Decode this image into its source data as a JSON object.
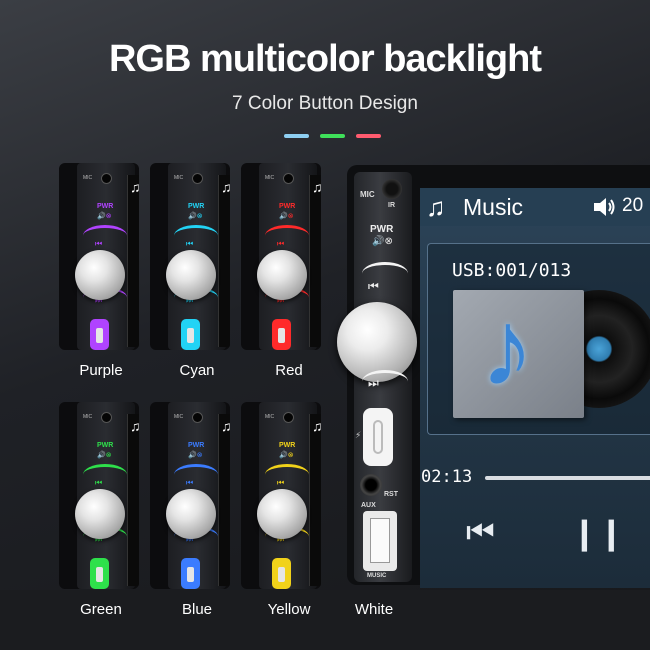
{
  "header": {
    "title": "RGB multicolor backlight",
    "subtitle": "7 Color Button Design",
    "dash_colors": [
      "#8ecff2",
      "#3fe05a",
      "#ff5b6f"
    ]
  },
  "panel_text": {
    "mic": "MIC",
    "pwr": "PWR",
    "pwr_symbol": "🔊⊗",
    "note": "♫",
    "prev": "⏮",
    "next": "⏭"
  },
  "variants": [
    {
      "label": "Purple",
      "color": "#b043ff"
    },
    {
      "label": "Cyan",
      "color": "#22d3f5"
    },
    {
      "label": "Red",
      "color": "#ff2a2a"
    },
    {
      "label": "Green",
      "color": "#2ee04b"
    },
    {
      "label": "Blue",
      "color": "#3b7cff"
    },
    {
      "label": "Yellow",
      "color": "#f1d21a"
    },
    {
      "label": "White",
      "color": "#ffffff"
    }
  ],
  "unit": {
    "mic_label": "MIC",
    "ir_label": "IR",
    "pwr_label": "PWR",
    "pwr_symbol": "🔊⊗",
    "prev_symbol": "⏮",
    "next_symbol": "⏭",
    "rst_label": "RST",
    "aux_label": "AUX",
    "music_label": "MUSIC",
    "bolt": "⚡"
  },
  "screen": {
    "title": "Music",
    "note_icon": "♫",
    "volume_icon": "speaker-icon",
    "volume": "20",
    "source": "USB:001/013",
    "album_icon": "♪",
    "elapsed": "02:13",
    "progress": 0,
    "prev_btn": "⏮",
    "pause_btn": "❙❙"
  }
}
